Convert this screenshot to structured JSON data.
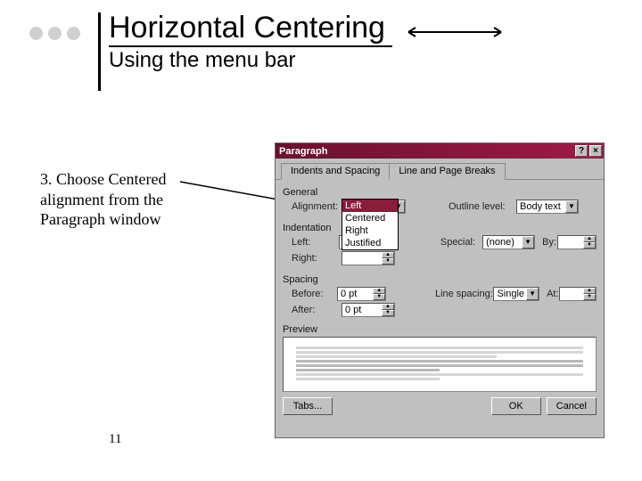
{
  "slide": {
    "title": "Horizontal Centering",
    "subtitle": "Using the menu bar",
    "instruction": "3.  Choose Centered alignment from the Paragraph window",
    "number": "11"
  },
  "dialog": {
    "title": "Paragraph",
    "help_btn": "?",
    "close_btn": "×",
    "tabs": {
      "indents": "Indents and Spacing",
      "linebreaks": "Line and Page Breaks"
    },
    "general": {
      "label": "General",
      "align_label": "Alignment:",
      "align_value": "Left",
      "outline_label": "Outline level:",
      "outline_value": "Body text",
      "options": {
        "left": "Left",
        "centered": "Centered",
        "right": "Right",
        "justified": "Justified"
      }
    },
    "indent": {
      "label": "Indentation",
      "left_label": "Left:",
      "left_value": "",
      "right_label": "Right:",
      "right_value": "",
      "special_label": "Special:",
      "special_value": "(none)",
      "by_label": "By:",
      "by_value": ""
    },
    "spacing": {
      "label": "Spacing",
      "before_label": "Before:",
      "before_value": "0 pt",
      "after_label": "After:",
      "after_value": "0 pt",
      "linespacing_label": "Line spacing:",
      "linespacing_value": "Single",
      "at_label": "At:",
      "at_value": ""
    },
    "preview_label": "Preview",
    "buttons": {
      "tabs": "Tabs...",
      "ok": "OK",
      "cancel": "Cancel"
    }
  }
}
